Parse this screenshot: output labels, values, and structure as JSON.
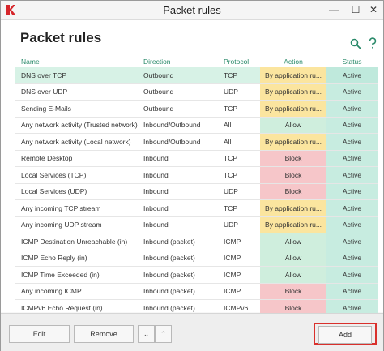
{
  "window": {
    "title": "Packet rules",
    "close_symbol": "✕",
    "min_symbol": "—",
    "max_symbol": "☐"
  },
  "page": {
    "title": "Packet rules"
  },
  "table": {
    "headers": [
      "Name",
      "Direction",
      "Protocol",
      "Action",
      "Status"
    ],
    "rows": [
      {
        "name": "DNS over TCP",
        "direction": "Outbound",
        "protocol": "TCP",
        "action": "By application ru...",
        "status": "Active",
        "selected": true
      },
      {
        "name": "DNS over UDP",
        "direction": "Outbound",
        "protocol": "UDP",
        "action": "By application ru...",
        "status": "Active"
      },
      {
        "name": "Sending E-Mails",
        "direction": "Outbound",
        "protocol": "TCP",
        "action": "By application ru...",
        "status": "Active"
      },
      {
        "name": "Any network activity (Trusted network)",
        "direction": "Inbound/Outbound",
        "protocol": "All",
        "action": "Allow",
        "status": "Active"
      },
      {
        "name": "Any network activity (Local network)",
        "direction": "Inbound/Outbound",
        "protocol": "All",
        "action": "By application ru...",
        "status": "Active"
      },
      {
        "name": "Remote Desktop",
        "direction": "Inbound",
        "protocol": "TCP",
        "action": "Block",
        "status": "Active"
      },
      {
        "name": "Local Services (TCP)",
        "direction": "Inbound",
        "protocol": "TCP",
        "action": "Block",
        "status": "Active"
      },
      {
        "name": "Local Services (UDP)",
        "direction": "Inbound",
        "protocol": "UDP",
        "action": "Block",
        "status": "Active"
      },
      {
        "name": "Any incoming TCP stream",
        "direction": "Inbound",
        "protocol": "TCP",
        "action": "By application ru...",
        "status": "Active"
      },
      {
        "name": "Any incoming UDP stream",
        "direction": "Inbound",
        "protocol": "UDP",
        "action": "By application ru...",
        "status": "Active"
      },
      {
        "name": "ICMP Destination Unreachable (in)",
        "direction": "Inbound (packet)",
        "protocol": "ICMP",
        "action": "Allow",
        "status": "Active"
      },
      {
        "name": "ICMP Echo Reply (in)",
        "direction": "Inbound (packet)",
        "protocol": "ICMP",
        "action": "Allow",
        "status": "Active"
      },
      {
        "name": "ICMP Time Exceeded (in)",
        "direction": "Inbound (packet)",
        "protocol": "ICMP",
        "action": "Allow",
        "status": "Active"
      },
      {
        "name": "Any incoming ICMP",
        "direction": "Inbound (packet)",
        "protocol": "ICMP",
        "action": "Block",
        "status": "Active"
      },
      {
        "name": "ICMPv6 Echo Request (in)",
        "direction": "Inbound (packet)",
        "protocol": "ICMPv6",
        "action": "Block",
        "status": "Active"
      }
    ]
  },
  "footer": {
    "edit_label": "Edit",
    "remove_label": "Remove",
    "down_symbol": "⌄",
    "up_symbol": "⌃",
    "add_label": "Add"
  },
  "colors": {
    "accent": "#2a8a6a",
    "allow": "#cfeedd",
    "block": "#f6c6c9",
    "by_application": "#fbe59f",
    "active": "#c7ece0",
    "highlight_frame": "#d9302c"
  }
}
